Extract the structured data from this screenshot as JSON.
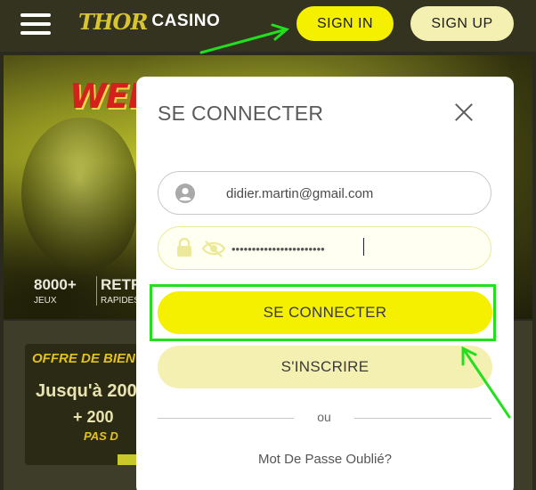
{
  "header": {
    "logo_thor": "THOR",
    "logo_casino": "CASINO",
    "signin_label": "SIGN IN",
    "signup_label": "SIGN UP"
  },
  "hero": {
    "welcome": "WELCO",
    "stat1_big": "8000+",
    "stat1_small": "JEUX",
    "stat2_big": "RETRA",
    "stat2_small": "RAPIDES"
  },
  "promo": {
    "title": "OFFRE DE BIENV",
    "line1": "Jusqu'à 200",
    "line2": "+ 200",
    "line3": "PAS D"
  },
  "modal": {
    "title": "SE CONNECTER",
    "email_value": "didier.martin@gmail.com",
    "password_value": "•••••••••••••••••••••••",
    "connect_label": "SE CONNECTER",
    "register_label": "S'INSCRIRE",
    "divider_text": "ou",
    "forgot_label": "Mot De Passe Oublié?"
  },
  "colors": {
    "accent_yellow": "#f4f000",
    "pale_yellow": "#f4f0b2",
    "annotation_green": "#23e01f"
  },
  "icons": {
    "menu": "hamburger-icon",
    "close": "close-icon",
    "user": "user-icon",
    "lock": "lock-icon",
    "eye": "eye-slash-icon"
  }
}
